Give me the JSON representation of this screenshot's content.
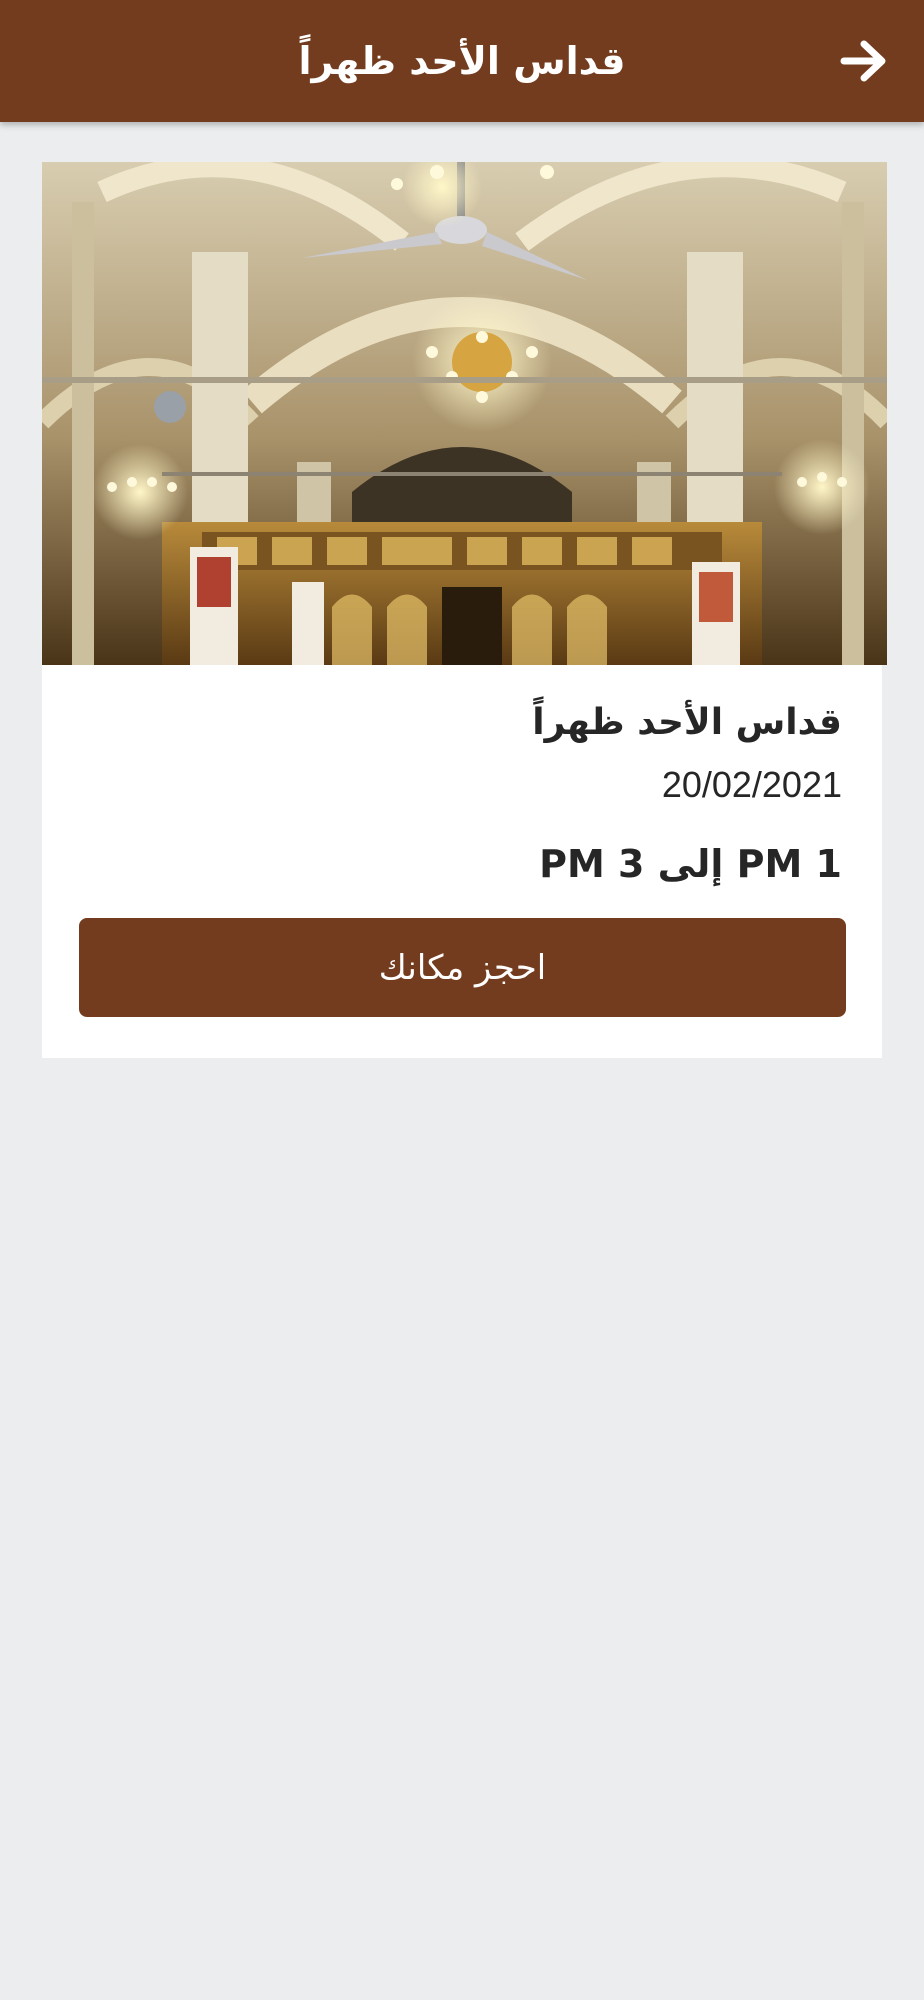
{
  "header": {
    "title": "قداس الأحد ظهراً",
    "back_icon": "arrow-right-icon"
  },
  "event": {
    "image_alt": "church interior photo",
    "title": "قداس الأحد ظهراً",
    "date": "20/02/2021",
    "time": "PM 1 إلى PM 3",
    "book_label": "احجز مكانك"
  },
  "colors": {
    "primary": "#743c1e",
    "background": "#ebedef",
    "text": "#262626"
  }
}
